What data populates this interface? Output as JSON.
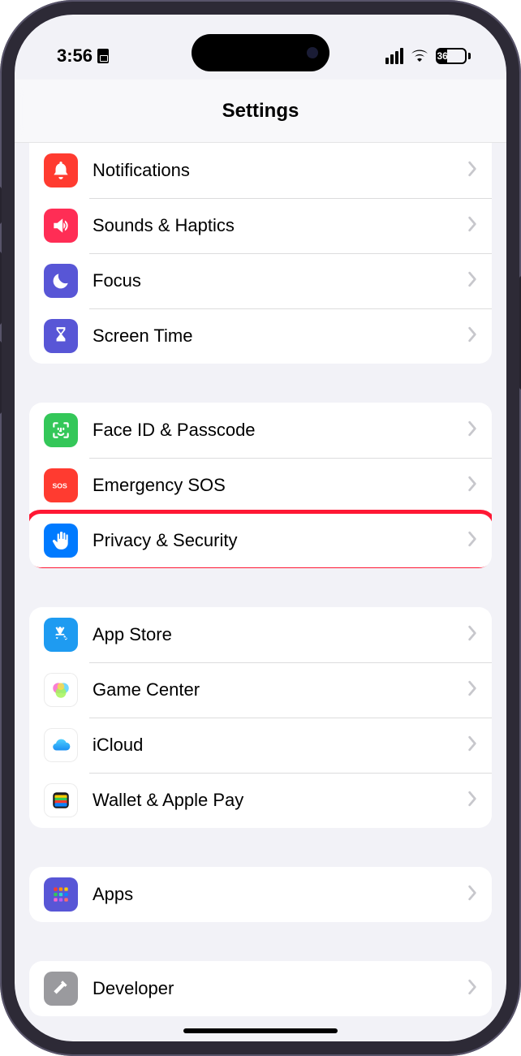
{
  "status": {
    "time": "3:56",
    "battery_pct": "36"
  },
  "header": {
    "title": "Settings"
  },
  "groups": [
    {
      "first": true,
      "rows": [
        {
          "id": "notifications",
          "label": "Notifications",
          "icon": "bell",
          "bg": "#ff3b30"
        },
        {
          "id": "sounds-haptics",
          "label": "Sounds & Haptics",
          "icon": "speaker",
          "bg": "#ff2d55"
        },
        {
          "id": "focus",
          "label": "Focus",
          "icon": "moon",
          "bg": "#5856d6"
        },
        {
          "id": "screen-time",
          "label": "Screen Time",
          "icon": "hourglass",
          "bg": "#5856d6"
        }
      ]
    },
    {
      "rows": [
        {
          "id": "face-id-passcode",
          "label": "Face ID & Passcode",
          "icon": "faceid",
          "bg": "#34c759"
        },
        {
          "id": "emergency-sos",
          "label": "Emergency SOS",
          "icon": "sos",
          "bg": "#ff3b30"
        },
        {
          "id": "privacy-security",
          "label": "Privacy & Security",
          "icon": "hand",
          "bg": "#007aff",
          "highlighted": true
        }
      ]
    },
    {
      "rows": [
        {
          "id": "app-store",
          "label": "App Store",
          "icon": "appstore",
          "bg": "#1e9bf1"
        },
        {
          "id": "game-center",
          "label": "Game Center",
          "icon": "gamecenter",
          "bg": "#ffffff"
        },
        {
          "id": "icloud",
          "label": "iCloud",
          "icon": "icloud",
          "bg": "#ffffff"
        },
        {
          "id": "wallet-apple-pay",
          "label": "Wallet & Apple Pay",
          "icon": "wallet",
          "bg": "#ffffff"
        }
      ]
    },
    {
      "rows": [
        {
          "id": "apps",
          "label": "Apps",
          "icon": "apps-grid",
          "bg": "#5856d6"
        }
      ]
    },
    {
      "rows": [
        {
          "id": "developer",
          "label": "Developer",
          "icon": "hammer",
          "bg": "#9a9a9e"
        }
      ]
    }
  ]
}
